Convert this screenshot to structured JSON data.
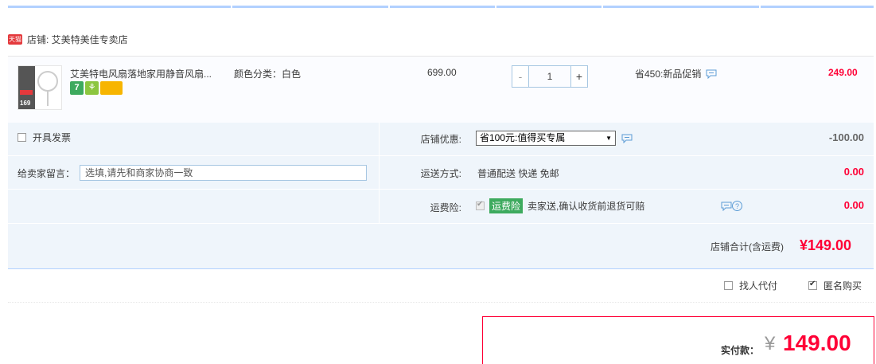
{
  "shop": {
    "badge": "天猫",
    "label": "店铺: 艾美特美佳专卖店"
  },
  "item": {
    "title": "艾美特电风扇落地家用静音风扇...",
    "sku": "颜色分类：白色",
    "unit_price": "699.00",
    "quantity": "1",
    "qty_minus": "-",
    "qty_plus": "+",
    "promo": "省450:新品促销",
    "total": "249.00",
    "thumb_price": "169",
    "service_icons": [
      "7",
      "⚘",
      ""
    ]
  },
  "options": {
    "invoice_label": "开具发票",
    "message_label": "给卖家留言：",
    "message_placeholder": "选填,请先和商家协商一致",
    "shop_discount_label": "店铺优惠:",
    "shop_discount_selected": "省100元:值得买专属",
    "shop_discount_value": "-100.00",
    "shipping_label": "运送方式:",
    "shipping_text": "普通配送 快递 免邮",
    "shipping_value": "0.00",
    "insurance_label": "运费险:",
    "insurance_badge": "运费险",
    "insurance_text": "卖家送,确认收货前退货可赔",
    "insurance_value": "0.00",
    "help_glyph": "?"
  },
  "summary": {
    "subtotal_label": "店铺合计(含运费)",
    "subtotal_value": "¥149.00",
    "pay_by_other_label": "找人代付",
    "anonymous_label": "匿名购买",
    "pay_label": "实付款：",
    "pay_currency": "¥",
    "pay_value": "149.00"
  },
  "colors": {
    "accent_red": "#ff0036",
    "light_blue": "#eff5fb",
    "border_blue": "#b2d1ff",
    "green": "#3daa5e"
  },
  "icons": [
    "tmall-icon",
    "chat-icon",
    "help-icon",
    "checkbox-icon"
  ]
}
